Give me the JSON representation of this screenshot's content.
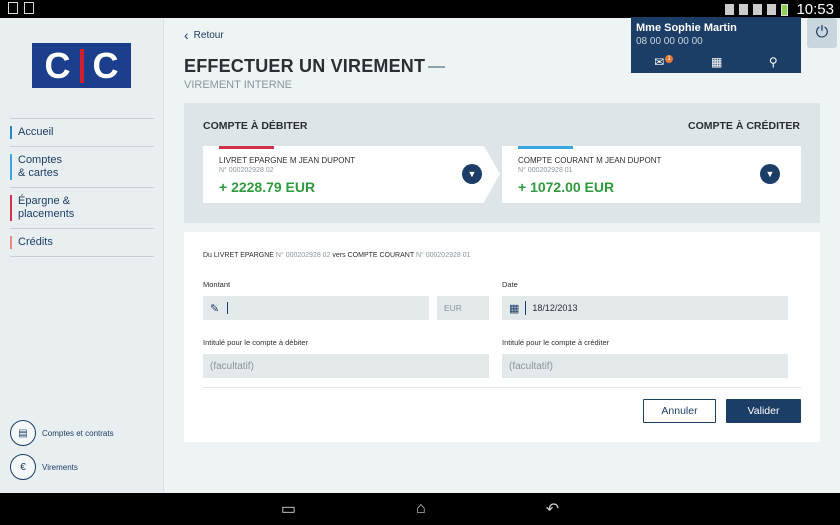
{
  "statusbar": {
    "time": "10:53",
    "battery_color": "#8fd14f"
  },
  "sidebar": {
    "logo_text": "CIC",
    "items": [
      {
        "label": "Accueil"
      },
      {
        "label": "Comptes\n& cartes"
      },
      {
        "label": "Épargne &\nplacements"
      },
      {
        "label": "Crédits"
      }
    ],
    "links": [
      {
        "label": "Comptes et contrats",
        "icon": "document-icon"
      },
      {
        "label": "Virements",
        "icon": "euro-transfer-icon"
      }
    ]
  },
  "header": {
    "back_label": "Retour",
    "title": "EFFECTUER UN VIREMENT",
    "subtitle": "VIREMENT INTERNE"
  },
  "user": {
    "name": "Mme Sophie Martin",
    "id": "08 00 00 00 00",
    "mail_count": "1",
    "calendar_day": "1"
  },
  "accounts": {
    "debit_label": "COMPTE À DÉBITER",
    "credit_label": "COMPTE À CRÉDITER",
    "debit": {
      "name": "LIVRET EPARGNE M JEAN DUPONT",
      "number": "N° 000202928 02",
      "balance": "+ 2228.79 EUR",
      "accent": "#d0324a"
    },
    "credit": {
      "name": "COMPTE COURANT M JEAN DUPONT",
      "number": "N° 000202928 01",
      "balance": "+ 1072.00 EUR",
      "accent": "#39a7db"
    }
  },
  "form": {
    "summary_from": "Du LIVRET EPARGNE",
    "summary_from_num": "N° 000202928 02",
    "summary_vers": "vers",
    "summary_to": "COMPTE COURANT",
    "summary_to_num": "N° 000202928 01",
    "amount_label": "Montant",
    "amount_value": "",
    "currency": "EUR",
    "date_label": "Date",
    "date_value": "18/12/2013",
    "debit_note_label": "Intitulé pour le compte à débiter",
    "debit_note_placeholder": "(facultatif)",
    "credit_note_label": "Intitulé pour le compte à créditer",
    "credit_note_placeholder": "(facultatif)",
    "cancel_label": "Annuler",
    "ok_label": "Valider"
  },
  "colors": {
    "brand": "#1c3e66",
    "positive": "#2f9a3e",
    "logo_blue": "#1b3f8c",
    "logo_red": "#d0202e"
  }
}
